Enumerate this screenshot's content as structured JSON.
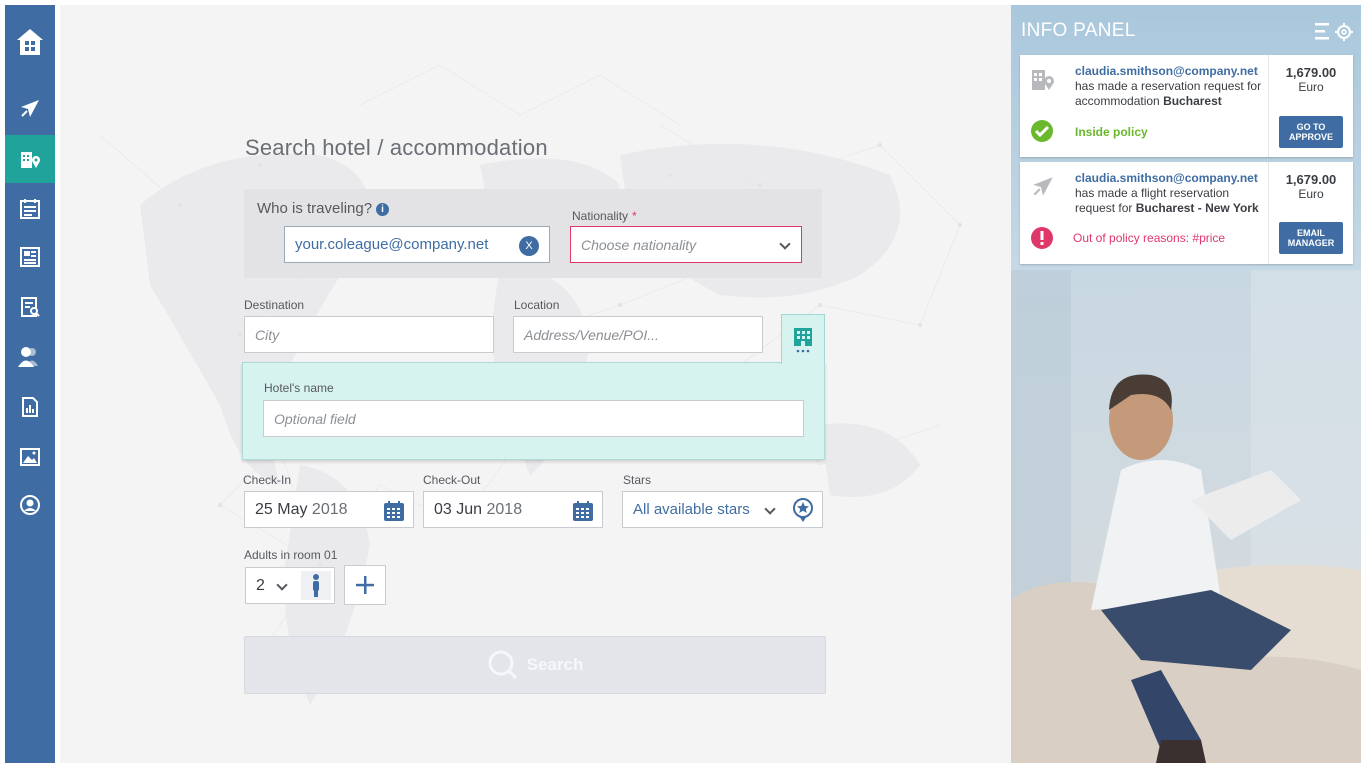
{
  "search": {
    "title": "Search hotel / accommodation",
    "who_label": "Who is traveling?",
    "traveler_value": "your.coleague@company.net",
    "clear_label": "X",
    "nationality_label": "Nationality",
    "nationality_required": "*",
    "nationality_placeholder": "Choose nationality",
    "destination_label": "Destination",
    "destination_placeholder": "City",
    "location_label": "Location",
    "location_placeholder": "Address/Venue/POI...",
    "hotel_name_label": "Hotel's name",
    "hotel_name_placeholder": "Optional field",
    "checkin_label": "Check-In",
    "checkin_daymonth": "25 May",
    "checkin_year": "2018",
    "checkout_label": "Check-Out",
    "checkout_daymonth": "03 Jun",
    "checkout_year": "2018",
    "stars_label": "Stars",
    "stars_value": "All available stars",
    "adults_label": "Adults in room 01",
    "adults_value": "2",
    "search_button": "Search"
  },
  "info_panel": {
    "title": "INFO PANEL",
    "cards": [
      {
        "email": "claudia.smithson@company.net",
        "desc_prefix": "has made a reservation request for accommodation",
        "desc_bold": "Bucharest",
        "amount": "1,679.00",
        "currency": "Euro",
        "status": "Inside policy",
        "action": "GO TO APPROVE",
        "status_color": "#6ab82c",
        "type_icon": "hotel-location-icon"
      },
      {
        "email": "claudia.smithson@company.net",
        "desc_prefix": "has made a flight reservation request for",
        "desc_bold": "Bucharest - New York",
        "amount": "1,679.00",
        "currency": "Euro",
        "status": "Out of policy reasons: #price",
        "action": "EMAIL MANAGER",
        "status_color": "#e0376a",
        "type_icon": "airplane-icon"
      }
    ]
  },
  "colors": {
    "nav": "#3f6da3",
    "nav_active": "#1fa39b",
    "accent": "#3f6da3",
    "teal_panel": "#d7f3f0",
    "error": "#e0376a",
    "success": "#6ab82c"
  }
}
